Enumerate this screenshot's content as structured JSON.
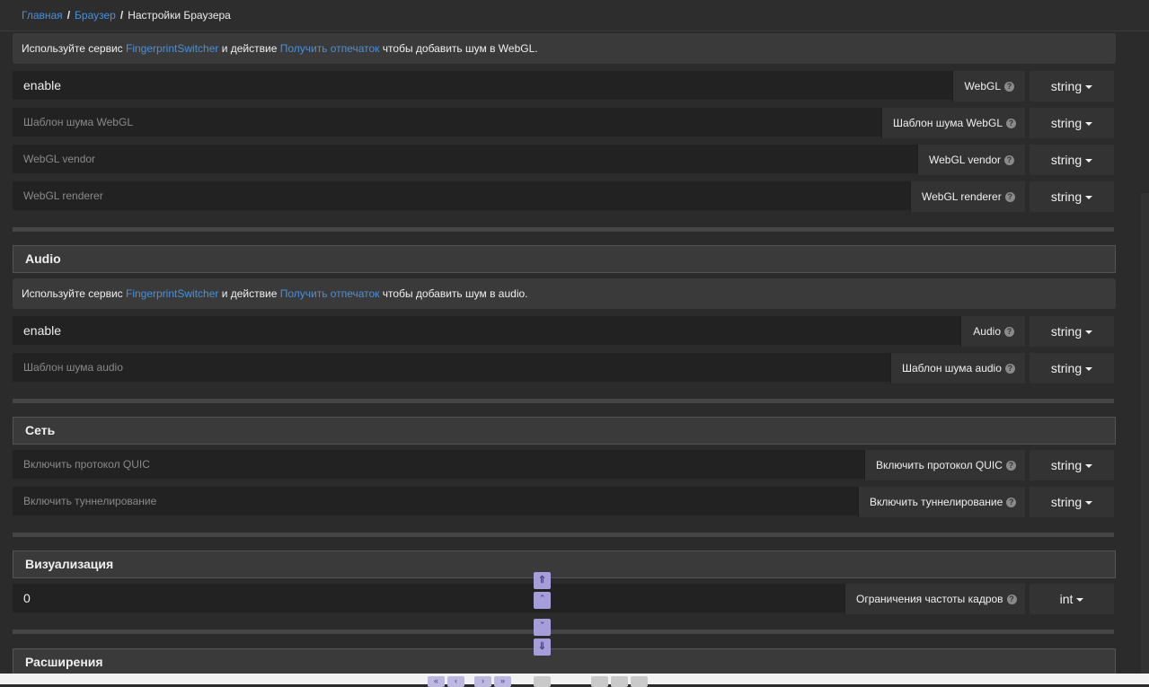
{
  "breadcrumb": {
    "home": "Главная",
    "browser": "Браузер",
    "current": "Настройки Браузера"
  },
  "notice_link1": "FingerprintSwitcher",
  "notice_link2": "Получить отпечаток",
  "notice_prefix": "Используйте сервис",
  "notice_mid": "и действие",
  "webgl": {
    "notice_suffix": "чтобы добавить шум в WebGL.",
    "rows": [
      {
        "value": "enable",
        "placeholder": "",
        "label": "WebGL",
        "type": "string"
      },
      {
        "value": "",
        "placeholder": "Шаблон шума WebGL",
        "label": "Шаблон шума WebGL",
        "type": "string"
      },
      {
        "value": "",
        "placeholder": "WebGL vendor",
        "label": "WebGL vendor",
        "type": "string"
      },
      {
        "value": "",
        "placeholder": "WebGL renderer",
        "label": "WebGL renderer",
        "type": "string"
      }
    ]
  },
  "audio": {
    "title": "Audio",
    "notice_suffix": "чтобы добавить шум в audio.",
    "rows": [
      {
        "value": "enable",
        "placeholder": "",
        "label": "Audio",
        "type": "string"
      },
      {
        "value": "",
        "placeholder": "Шаблон шума audio",
        "label": "Шаблон шума audio",
        "type": "string"
      }
    ]
  },
  "network": {
    "title": "Сеть",
    "rows": [
      {
        "value": "",
        "placeholder": "Включить протокол QUIC",
        "label": "Включить протокол QUIC",
        "type": "string"
      },
      {
        "value": "",
        "placeholder": "Включить туннелирование",
        "label": "Включить туннелирование",
        "type": "string"
      }
    ]
  },
  "visualization": {
    "title": "Визуализация",
    "rows": [
      {
        "value": "0",
        "placeholder": "",
        "label": "Ограничения частоты кадров",
        "type": "int"
      }
    ]
  },
  "extensions": {
    "title": "Расширения"
  },
  "icons": {
    "help": "question-circle-icon",
    "caret": "caret-down-icon",
    "scroll_top": "double-chevron-up-icon",
    "scroll_up": "chevron-up-icon",
    "scroll_down": "chevron-down-icon",
    "scroll_bottom": "double-chevron-down-icon"
  },
  "colors": {
    "link": "#4a90d9",
    "background": "#2b2b2b",
    "nav_button": "#a59ed8"
  }
}
